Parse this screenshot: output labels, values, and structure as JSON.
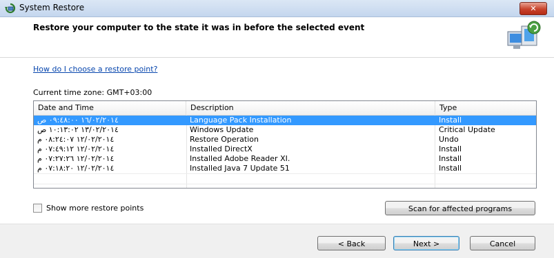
{
  "window": {
    "title": "System Restore",
    "close_label": "✕"
  },
  "header": {
    "heading": "Restore your computer to the state it was in before the selected event"
  },
  "help_link": "How do I choose a restore point?",
  "time_zone": "Current time zone: GMT+03:00",
  "table": {
    "columns": [
      "Date and Time",
      "Description",
      "Type"
    ],
    "rows": [
      {
        "date": "١٦/٠٢/٢٠١٤ ٠٩:٤٨:٠٠ ص",
        "description": "Language Pack Installation",
        "type": "Install"
      },
      {
        "date": "١٣/٠٢/٢٠١٤ ١٠:١٣:٠٢ ص",
        "description": "Windows Update",
        "type": "Critical Update"
      },
      {
        "date": "١٢/٠٢/٢٠١٤ ٠٨:٢٤:٠٧ م",
        "description": "Restore Operation",
        "type": "Undo"
      },
      {
        "date": "١٢/٠٢/٢٠١٤ ٠٧:٤٩:١٢ م",
        "description": "Installed DirectX",
        "type": "Install"
      },
      {
        "date": "١٢/٠٢/٢٠١٤ ٠٧:٢٧:٢٦ م",
        "description": "Installed Adobe Reader XI.",
        "type": "Install"
      },
      {
        "date": "١٢/٠٢/٢٠١٤ ٠٧:١٨:٢٠ م",
        "description": "Installed Java 7 Update 51",
        "type": "Install"
      }
    ],
    "selected_index": 0
  },
  "show_more_label": "Show more restore points",
  "scan_button": "Scan for affected programs",
  "buttons": {
    "back": "< Back",
    "next": "Next >",
    "cancel": "Cancel"
  },
  "colors": {
    "selection": "#3399ff",
    "link": "#0645ad",
    "close": "#c8432c"
  },
  "icons": {
    "title": "system-restore-icon",
    "header": "restore-computer-icon"
  }
}
